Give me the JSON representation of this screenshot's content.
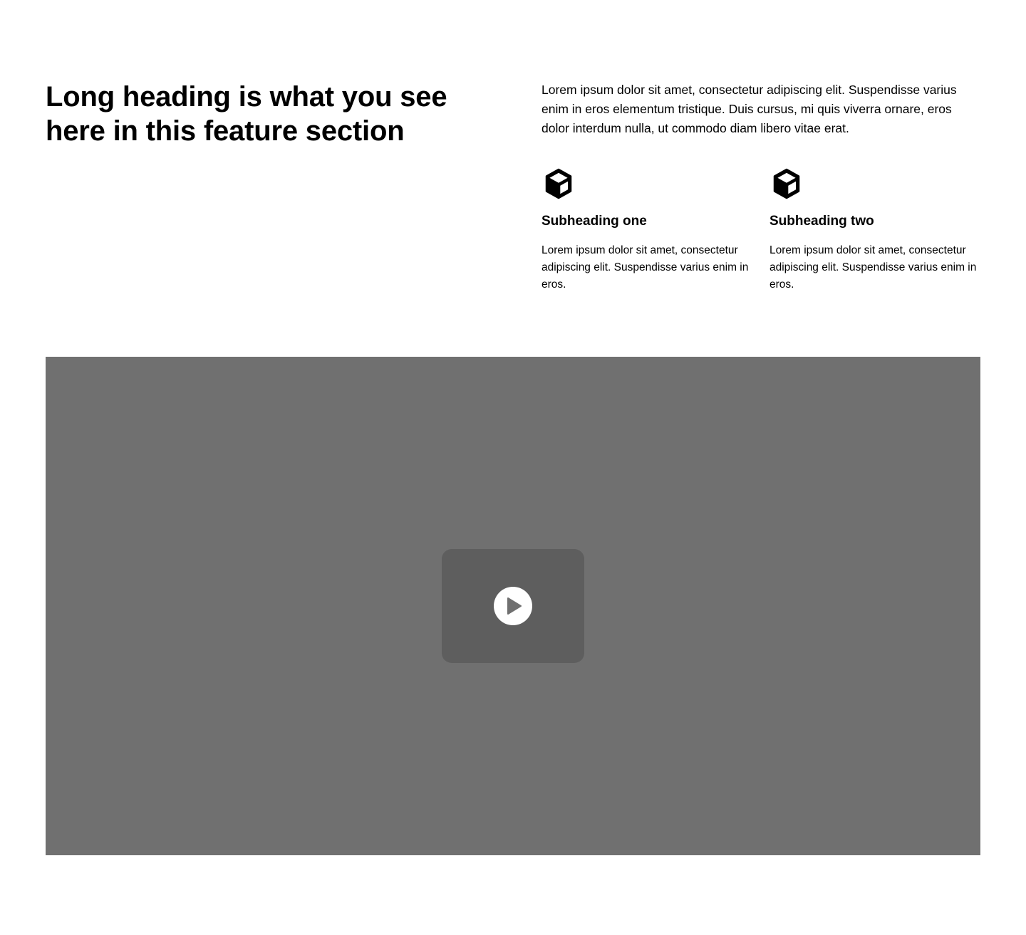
{
  "feature_section": {
    "heading": "Long heading is what you see here in this feature section",
    "intro": "Lorem ipsum dolor sit amet, consectetur adipiscing elit. Suspendisse varius enim in eros elementum tristique. Duis cursus, mi quis viverra ornare, eros dolor interdum nulla, ut commodo diam libero vitae erat.",
    "features": [
      {
        "icon": "cube-icon",
        "title": "Subheading one",
        "text": "Lorem ipsum dolor sit amet, consectetur adipiscing elit. Suspendisse varius enim in eros."
      },
      {
        "icon": "cube-icon",
        "title": "Subheading two",
        "text": "Lorem ipsum dolor sit amet, consectetur adipiscing elit. Suspendisse varius enim in eros."
      }
    ]
  },
  "video": {
    "play_icon": "play-icon",
    "colors": {
      "background": "#707070",
      "card": "#5e5e5e",
      "button": "#ffffff",
      "glyph": "#707070"
    }
  }
}
